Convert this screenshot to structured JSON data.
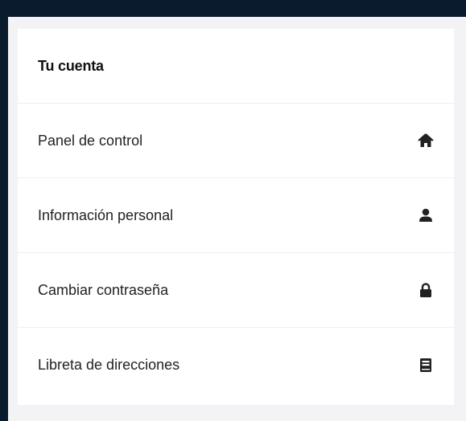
{
  "account_menu": {
    "title": "Tu cuenta",
    "items": [
      {
        "label": "Panel de control",
        "icon": "home-icon"
      },
      {
        "label": "Información personal",
        "icon": "user-icon"
      },
      {
        "label": "Cambiar contraseña",
        "icon": "lock-icon"
      },
      {
        "label": "Libreta de direcciones",
        "icon": "address-book-icon"
      }
    ]
  },
  "colors": {
    "outer_background": "#0b1b2e",
    "panel_background": "#f3f3f5",
    "card_background": "#ffffff",
    "icon_color": "#222222"
  }
}
